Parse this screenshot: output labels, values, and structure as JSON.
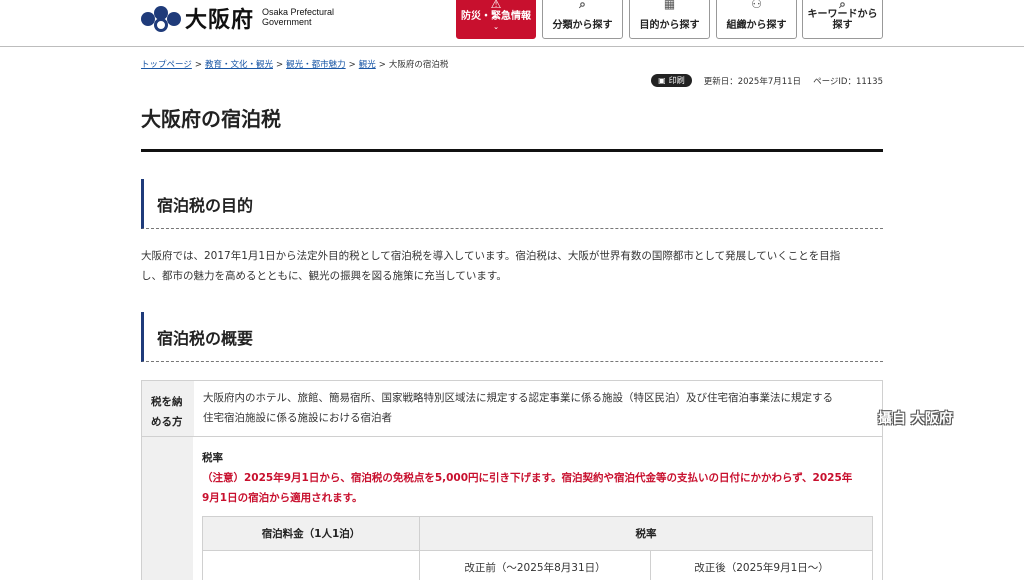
{
  "header": {
    "logo_jp": "大阪府",
    "logo_en_line1": "Osaka Prefectural",
    "logo_en_line2": "Government",
    "nav": [
      {
        "label": "防災・緊急情報",
        "icon": "warning-icon",
        "color": "#c8102e"
      },
      {
        "label": "分類から探す",
        "icon": "category-search-icon"
      },
      {
        "label": "目的から探す",
        "icon": "grid-icon"
      },
      {
        "label": "組織から探す",
        "icon": "organization-icon"
      },
      {
        "label_line1": "キーワードから",
        "label_line2": "探す",
        "icon": "search-icon"
      }
    ]
  },
  "breadcrumb": [
    {
      "label": "トップページ",
      "link": true
    },
    {
      "label": "教育・文化・観光",
      "link": true
    },
    {
      "label": "観光・都市魅力",
      "link": true
    },
    {
      "label": "観光",
      "link": true
    },
    {
      "label": "大阪府の宿泊税",
      "link": false
    }
  ],
  "meta": {
    "print_label": "印刷",
    "updated": "更新日：2025年7月11日",
    "page_id": "ページID：11135"
  },
  "page_title": "大阪府の宿泊税",
  "section1": {
    "heading": "宿泊税の目的",
    "body_line1": "大阪府では、2017年1月1日から法定外目的税として宿泊税を導入しています。宿泊税は、大阪が世界有数の国際都市として発展していくことを目指",
    "body_line2": "し、都市の魅力を高めるとともに、観光の振興を図る施策に充当しています。"
  },
  "section2": {
    "heading": "宿泊税の概要",
    "row1_header_line1": "税を納",
    "row1_header_line2": "める方",
    "row1_line1": "大阪府内のホテル、旅館、簡易宿所、国家戦略特別区域法に規定する認定事業に係る施設（特区民泊）及び住宅宿泊事業法に規定する",
    "row1_line2": "住宅宿泊施設に係る施設における宿泊者",
    "rate_label": "税率",
    "notice_line1": "（注意）2025年9月1日から、宿泊税の免税点を5,000円に引き下げます。宿泊契約や宿泊代金等の支払いの日付にかかわらず、2025年",
    "notice_line2": "9月1日の宿泊から適用されます。",
    "table_head_fee": "宿泊料金（1人1泊）",
    "table_head_rate": "税率",
    "table_before": "改正前（～2025年8月31日）",
    "table_after": "改正後（2025年9月1日～）"
  },
  "watermark": "攝自 大阪府"
}
